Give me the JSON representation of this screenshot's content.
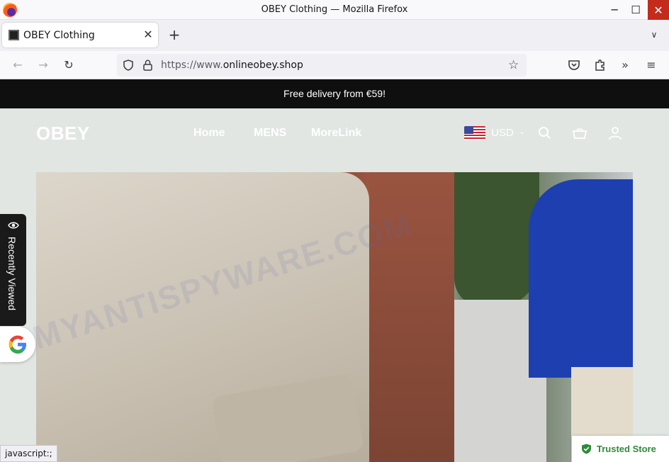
{
  "window": {
    "title": "OBEY Clothing — Mozilla Firefox",
    "controls": {
      "minimize": "─",
      "maximize": "☐",
      "close": "✕"
    }
  },
  "tabs": [
    {
      "title": "OBEY Clothing",
      "close": "✕",
      "favicon": "obey-favicon"
    }
  ],
  "tabstrip": {
    "new_tab": "+",
    "list_tabs": "∨"
  },
  "navbar": {
    "back": "←",
    "forward": "→",
    "reload": "↻",
    "url_prefix": "https://www.",
    "url_domain": "onlineobey.shop",
    "bookmark": "☆",
    "toolbar_icons": [
      "pocket-icon",
      "extensions-icon",
      "overflow-icon",
      "menu-icon"
    ],
    "overflow": "»",
    "menu": "≡"
  },
  "page": {
    "announcement": "Free delivery from €59!",
    "logo": "OBEY",
    "nav": [
      "Home",
      "MENS",
      "MoreLink"
    ],
    "currency": "USD",
    "currency_caret": "⌄",
    "recently_viewed": "Recently Viewed",
    "trusted_store": "Trusted Store",
    "watermark": "MYANTISPYWARE.COM"
  },
  "status_bar": "javascript:;",
  "colors": {
    "announcement_bg": "#0f0f0f",
    "header_bg": "#e1e6e3",
    "trusted_green": "#2e8b3a",
    "close_red": "#c42b1c"
  }
}
